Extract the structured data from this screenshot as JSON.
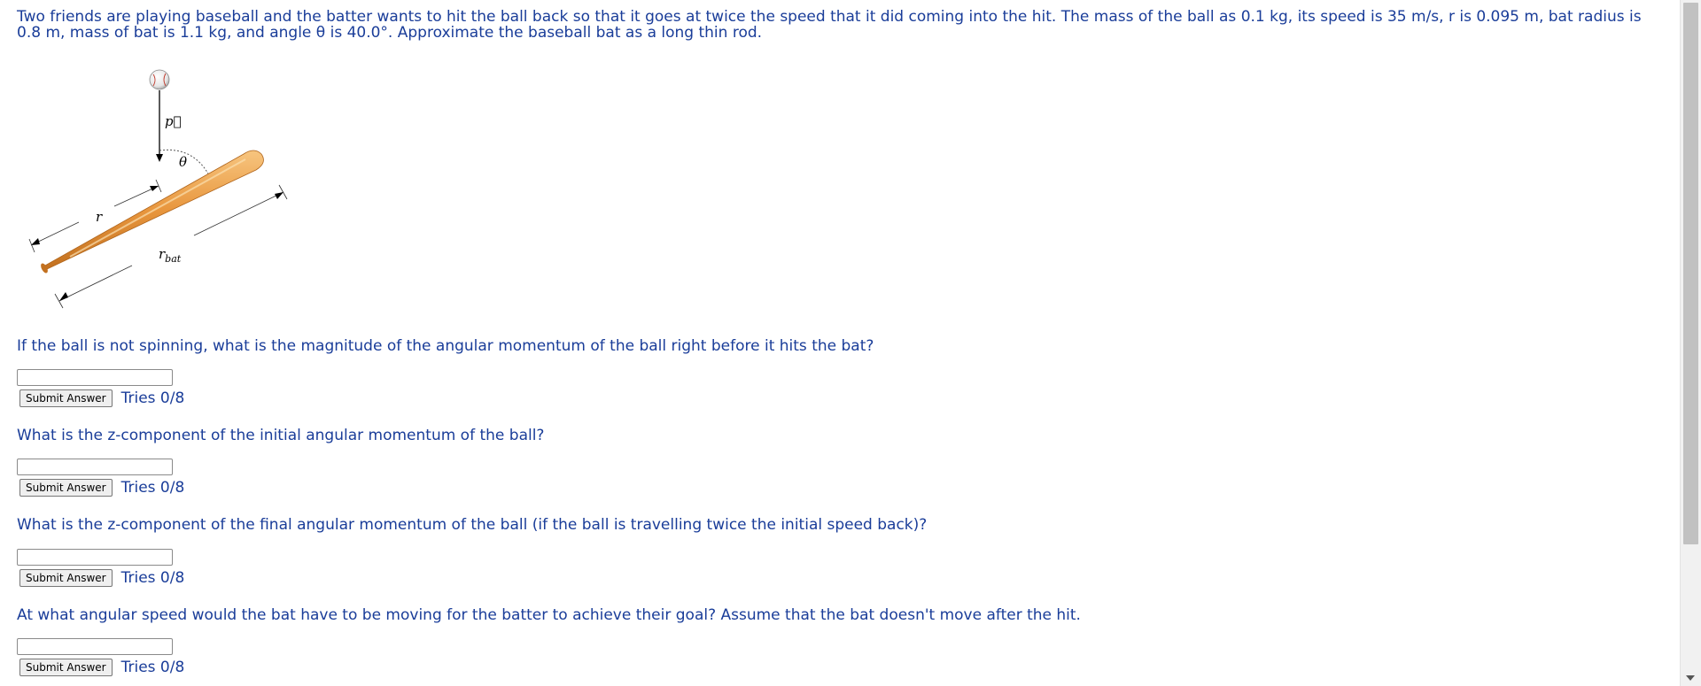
{
  "problem": {
    "text": "Two friends are playing baseball and the batter wants to hit the ball back so that it goes at twice the speed that it did coming into the hit. The mass of the ball as 0.1 kg, its speed is 35 m/s, r is 0.095 m, bat radius is 0.8 m, mass of bat is 1.1 kg, and angle θ is 40.0°. Approximate the baseball bat as a long thin rod."
  },
  "figure": {
    "label_p": "p⃗",
    "label_theta": "θ",
    "label_r": "r",
    "label_rbat": "r",
    "label_rbat_sub": "bat"
  },
  "questions": [
    {
      "text": "If the ball is not spinning, what is the magnitude of the angular momentum of the ball right before it hits the bat?",
      "input_value": "",
      "submit_label": "Submit Answer",
      "tries": "Tries 0/8"
    },
    {
      "text": "What is the z-component of the initial angular momentum of the ball?",
      "input_value": "",
      "submit_label": "Submit Answer",
      "tries": "Tries 0/8"
    },
    {
      "text": "What is the z-component of the final angular momentum of the ball (if the ball is travelling twice the initial speed back)?",
      "input_value": "",
      "submit_label": "Submit Answer",
      "tries": "Tries 0/8"
    },
    {
      "text": "At what angular speed would the bat have to be moving for the batter to achieve their goal? Assume that the bat doesn't move after the hit.",
      "input_value": "",
      "submit_label": "Submit Answer",
      "tries": "Tries 0/8"
    }
  ]
}
